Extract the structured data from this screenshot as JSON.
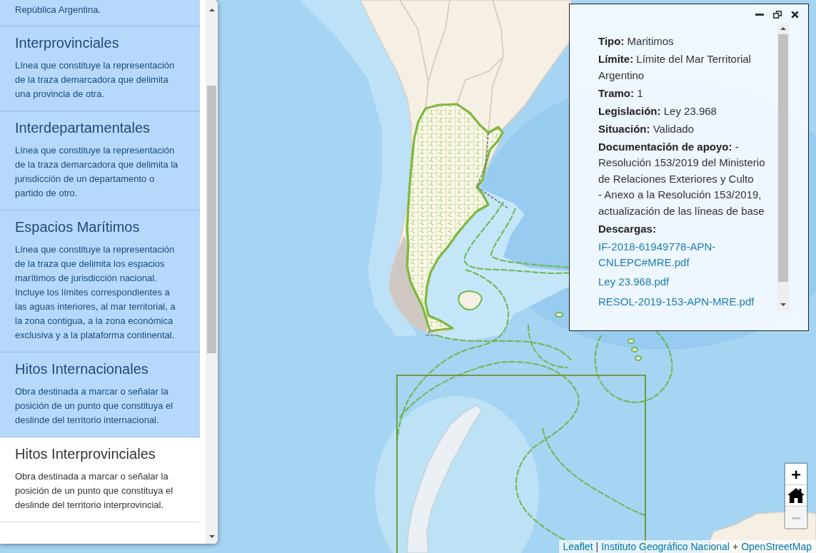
{
  "layer_panel": {
    "items": [
      {
        "description": "República Argentina.",
        "selected": true
      },
      {
        "title": "Interprovinciales",
        "description": "Línea que constituye la representación de la traza demarcadora que delimita una provincia de otra.",
        "selected": true
      },
      {
        "title": "Interdepartamentales",
        "description": "Línea que constituye la representación de la traza demarcadora que delimita la jurisdicción de un departamento o partido de otro.",
        "selected": true
      },
      {
        "title": "Espacios Marítimos",
        "description": "Línea que constituye la representación de la traza que delimita los espacios marítimos de jurisdicción nacional. Incluye los límites correspondientes a las aguas interiores, al mar territorial, a la zona contigua, a la zona económica exclusiva y a la plataforma continental.",
        "selected": true
      },
      {
        "title": "Hitos Internacionales",
        "description": "Obra destinada a marcar o señalar la posición de un punto que constituya el deslinde del territorio internacional.",
        "selected": true
      },
      {
        "title": "Hitos Interprovinciales",
        "description": "Obra destinada a marcar o señalar la posición de un punto que constituya el deslinde del territorio interprovincial.",
        "selected": false
      }
    ]
  },
  "popup": {
    "fields": [
      {
        "label": "Tipo:",
        "lines": [
          "Maritimos"
        ]
      },
      {
        "label": "Límite:",
        "lines": [
          "Límite del Mar Territorial Argentino"
        ]
      },
      {
        "label": "Tramo:",
        "lines": [
          "1"
        ]
      },
      {
        "label": "Legislación:",
        "lines": [
          "Ley 23.968"
        ]
      },
      {
        "label": "Situación:",
        "lines": [
          "Validado"
        ]
      },
      {
        "label": "Documentación de apoyo:",
        "lines": [
          "- Resolución 153/2019 del Ministerio de Relaciones Exteriores y Culto",
          "- Anexo a la Resolución 153/2019, actualización de las líneas de base"
        ]
      }
    ],
    "downloads_label": "Descargas:",
    "downloads": [
      "IF-2018-61949778-APN-CNLEPC#MRE.pdf",
      "Ley 23.968.pdf",
      "RESOL-2019-153-APN-MRE.pdf"
    ]
  },
  "zoom_controls": [
    {
      "kind": "zoom-in",
      "label": "+",
      "disabled": false
    },
    {
      "kind": "home",
      "disabled": false
    },
    {
      "kind": "zoom-out",
      "label": "−",
      "disabled": true
    }
  ],
  "attribution": [
    {
      "kind": "link",
      "text": "Leaflet"
    },
    {
      "kind": "separator",
      "text": "|"
    },
    {
      "kind": "link",
      "text": "Instituto Geográfico Nacional"
    },
    {
      "kind": "separator",
      "text": "+"
    },
    {
      "kind": "link",
      "text": "OpenStreetMap"
    }
  ]
}
